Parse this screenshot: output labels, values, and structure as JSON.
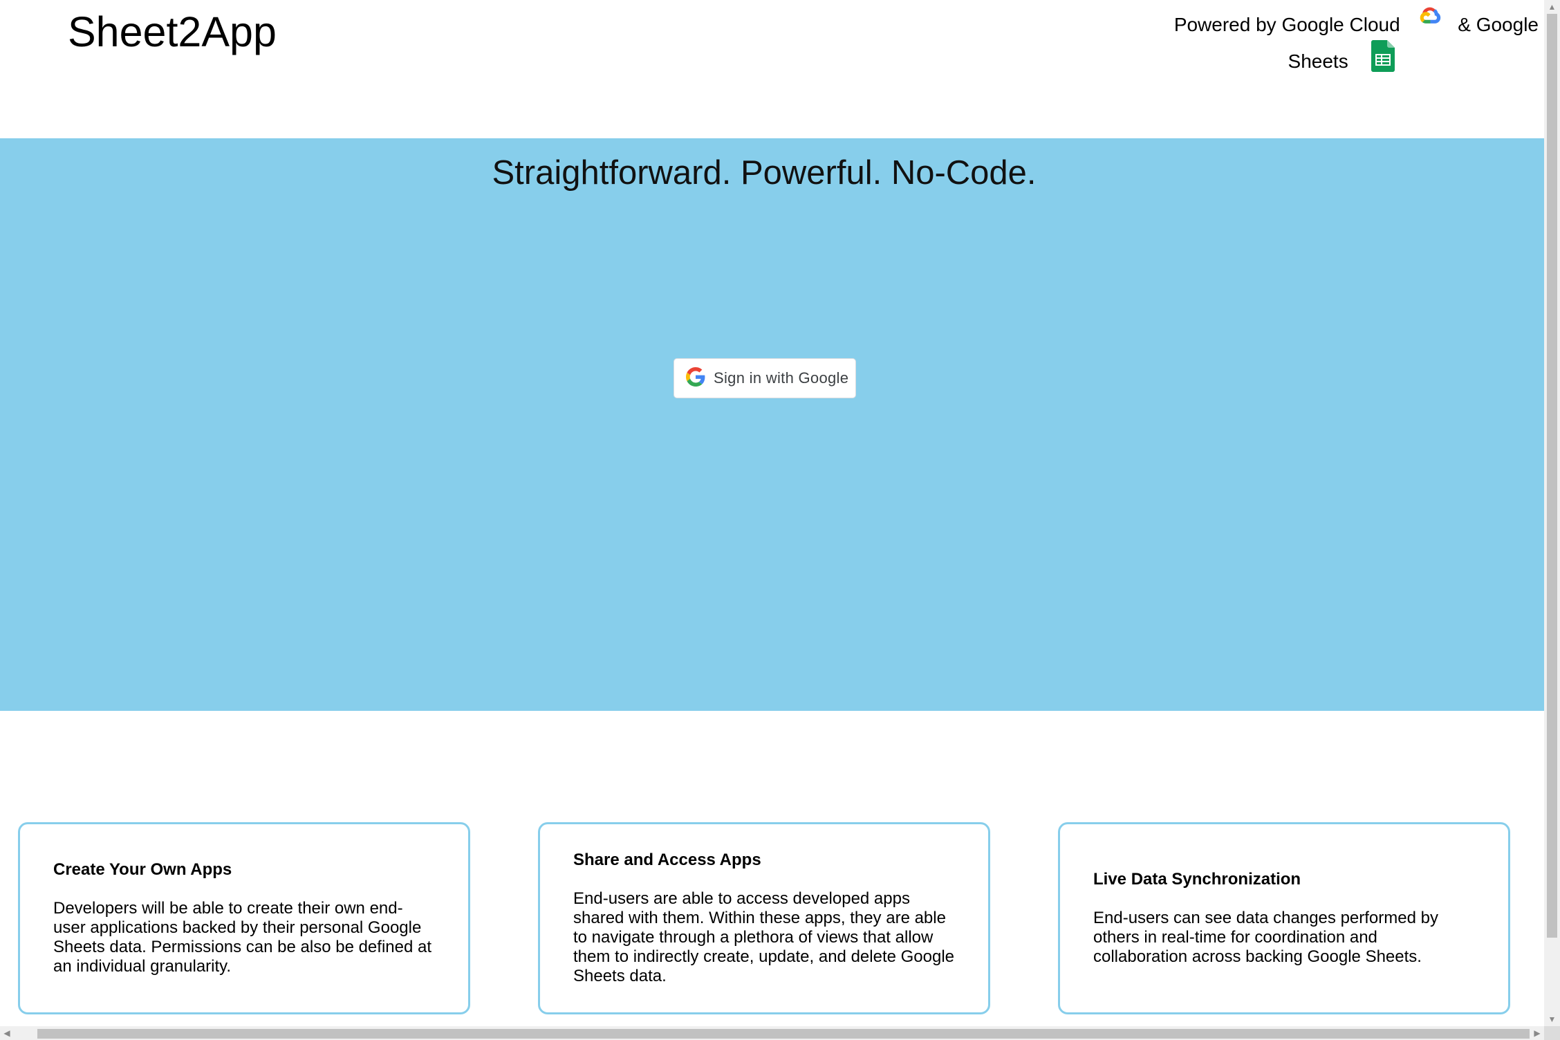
{
  "header": {
    "brand": "Sheet2App",
    "powered_prefix": "Powered by Google Cloud",
    "powered_mid": "& Google",
    "powered_suffix": "Sheets"
  },
  "hero": {
    "title": "Straightforward. Powerful. No-Code.",
    "signin_label": "Sign in with Google"
  },
  "features": [
    {
      "title": "Create Your Own Apps",
      "body": "Developers will be able to create their own end-user applications backed by their personal Google Sheets data. Permissions can be also be defined at an individual granularity."
    },
    {
      "title": "Share and Access Apps",
      "body": "End-users are able to access developed apps shared with them. Within these apps, they are able to navigate through a plethora of views that allow them to indirectly create, update, and delete Google Sheets data."
    },
    {
      "title": "Live Data Synchronization",
      "body": "End-users can see data changes performed by others in real-time for coordination and collaboration across backing Google Sheets."
    }
  ],
  "icons": {
    "cloud": "google-cloud-icon",
    "sheets": "google-sheets-icon",
    "google": "google-g-icon"
  },
  "colors": {
    "hero_bg": "#87ceeb",
    "card_border": "#87ceeb",
    "sheets_green": "#0f9d58"
  }
}
